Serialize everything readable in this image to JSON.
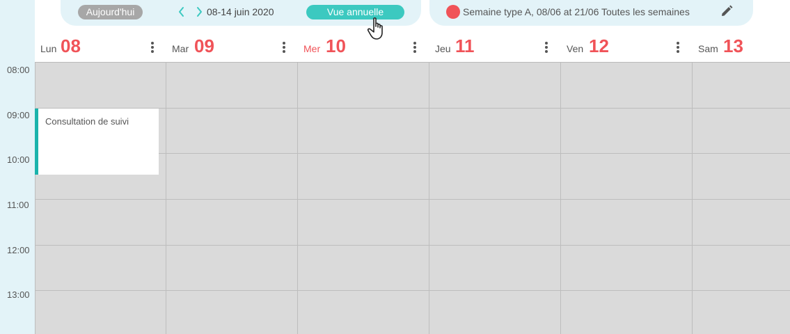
{
  "toolbar": {
    "today_label": "Aujourd'hui",
    "date_range": "08-14 juin 2020",
    "annual_view_label": "Vue annuelle",
    "week_label": "Semaine type A, 08/06 at 21/06 Toutes les semaines",
    "week_color": "#f05358",
    "accent_color": "#3cc9c0"
  },
  "days": [
    {
      "name": "Lun",
      "number": "08",
      "today": false
    },
    {
      "name": "Mar",
      "number": "09",
      "today": false
    },
    {
      "name": "Mer",
      "number": "10",
      "today": true
    },
    {
      "name": "Jeu",
      "number": "11",
      "today": false
    },
    {
      "name": "Ven",
      "number": "12",
      "today": false
    },
    {
      "name": "Sam",
      "number": "13",
      "today": false
    }
  ],
  "hours": [
    "08:00",
    "09:00",
    "10:00",
    "11:00",
    "12:00",
    "13:00"
  ],
  "events": [
    {
      "title": "Consultation de suivi",
      "day": "Lun",
      "start": "09:00",
      "end": "10:20",
      "color": "#1ab3ac"
    }
  ]
}
